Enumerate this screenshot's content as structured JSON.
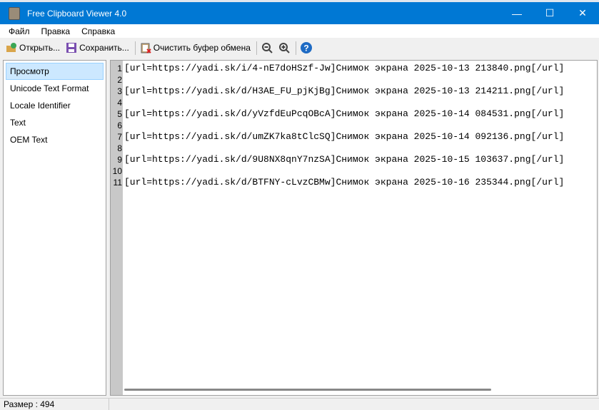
{
  "window": {
    "title": "Free Clipboard Viewer 4.0",
    "minimize": "—",
    "maximize": "☐",
    "close": "✕"
  },
  "menu": [
    "Файл",
    "Правка",
    "Справка"
  ],
  "toolbar": {
    "open": "Открыть...",
    "save": "Сохранить...",
    "clear": "Очистить буфер обмена"
  },
  "formats": [
    "Просмотр",
    "Unicode Text Format",
    "Locale Identifier",
    "Text",
    "OEM Text"
  ],
  "lines": [
    "[url=https://yadi.sk/i/4-nE7doHSzf-Jw]Снимок экрана 2025-10-13 213840.png[/url]",
    "",
    "[url=https://yadi.sk/d/H3AE_FU_pjKjBg]Снимок экрана 2025-10-13 214211.png[/url]",
    "",
    "[url=https://yadi.sk/d/yVzfdEuPcqOBcA]Снимок экрана 2025-10-14 084531.png[/url]",
    "",
    "[url=https://yadi.sk/d/umZK7ka8tClcSQ]Снимок экрана 2025-10-14 092136.png[/url]",
    "",
    "[url=https://yadi.sk/d/9U8NX8qnY7nzSA]Снимок экрана 2025-10-15 103637.png[/url]",
    "",
    "[url=https://yadi.sk/d/BTFNY-cLvzCBMw]Снимок экрана 2025-10-16 235344.png[/url]"
  ],
  "status": "Размер : 494"
}
